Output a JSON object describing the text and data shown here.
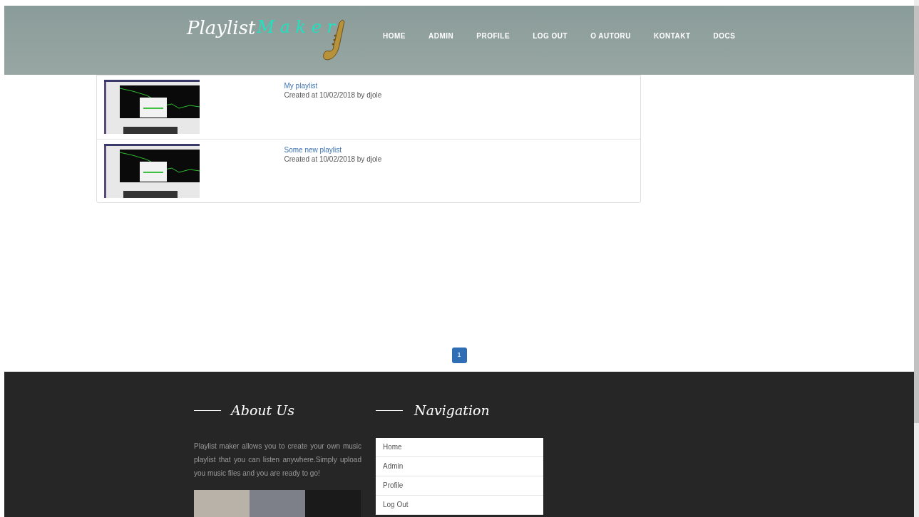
{
  "header": {
    "logo": {
      "first": "Playlist",
      "second": "M a k e r"
    },
    "nav": [
      {
        "label": "HOME"
      },
      {
        "label": "ADMIN"
      },
      {
        "label": "PROFILE"
      },
      {
        "label": "LOG OUT"
      },
      {
        "label": "O AUTORU"
      },
      {
        "label": "KONTAKT"
      },
      {
        "label": "DOCS"
      }
    ]
  },
  "playlists": [
    {
      "title": "My playlist",
      "meta": "Created at 10/02/2018 by djole"
    },
    {
      "title": "Some new playlist",
      "meta": "Created at 10/02/2018 by djole"
    }
  ],
  "pagination": [
    {
      "label": "1",
      "selected": true
    }
  ],
  "footer": {
    "about": {
      "title": "About Us",
      "text": "Playlist maker allows you to create your own music playlist that you can listen anywhere.Simply upload you music files and you are ready to go!"
    },
    "navigation": {
      "title": "Navigation",
      "items": [
        {
          "label": "Home"
        },
        {
          "label": "Admin"
        },
        {
          "label": "Profile"
        },
        {
          "label": "Log Out"
        }
      ]
    }
  }
}
